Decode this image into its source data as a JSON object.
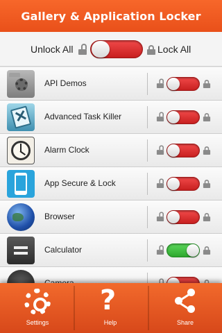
{
  "header": {
    "title": "Gallery & Application Locker"
  },
  "master": {
    "unlock_label": "Unlock All",
    "lock_label": "Lock All",
    "state": "unlock"
  },
  "apps": [
    {
      "name": "API Demos",
      "icon": "api-demos-icon",
      "locked": false
    },
    {
      "name": "Advanced Task Killer",
      "icon": "task-killer-icon",
      "locked": false
    },
    {
      "name": "Alarm Clock",
      "icon": "alarm-clock-icon",
      "locked": false
    },
    {
      "name": "App Secure & Lock",
      "icon": "app-secure-icon",
      "locked": false
    },
    {
      "name": "Browser",
      "icon": "browser-globe-icon",
      "locked": false
    },
    {
      "name": "Calculator",
      "icon": "calculator-icon",
      "locked": true
    },
    {
      "name": "Camera",
      "icon": "camera-icon",
      "locked": false
    }
  ],
  "bottom": {
    "settings": "Settings",
    "help": "Help",
    "share": "Share"
  },
  "colors": {
    "accent": "#ef5a23",
    "toggle_off": "#d83030",
    "toggle_on": "#3dbb3d"
  }
}
